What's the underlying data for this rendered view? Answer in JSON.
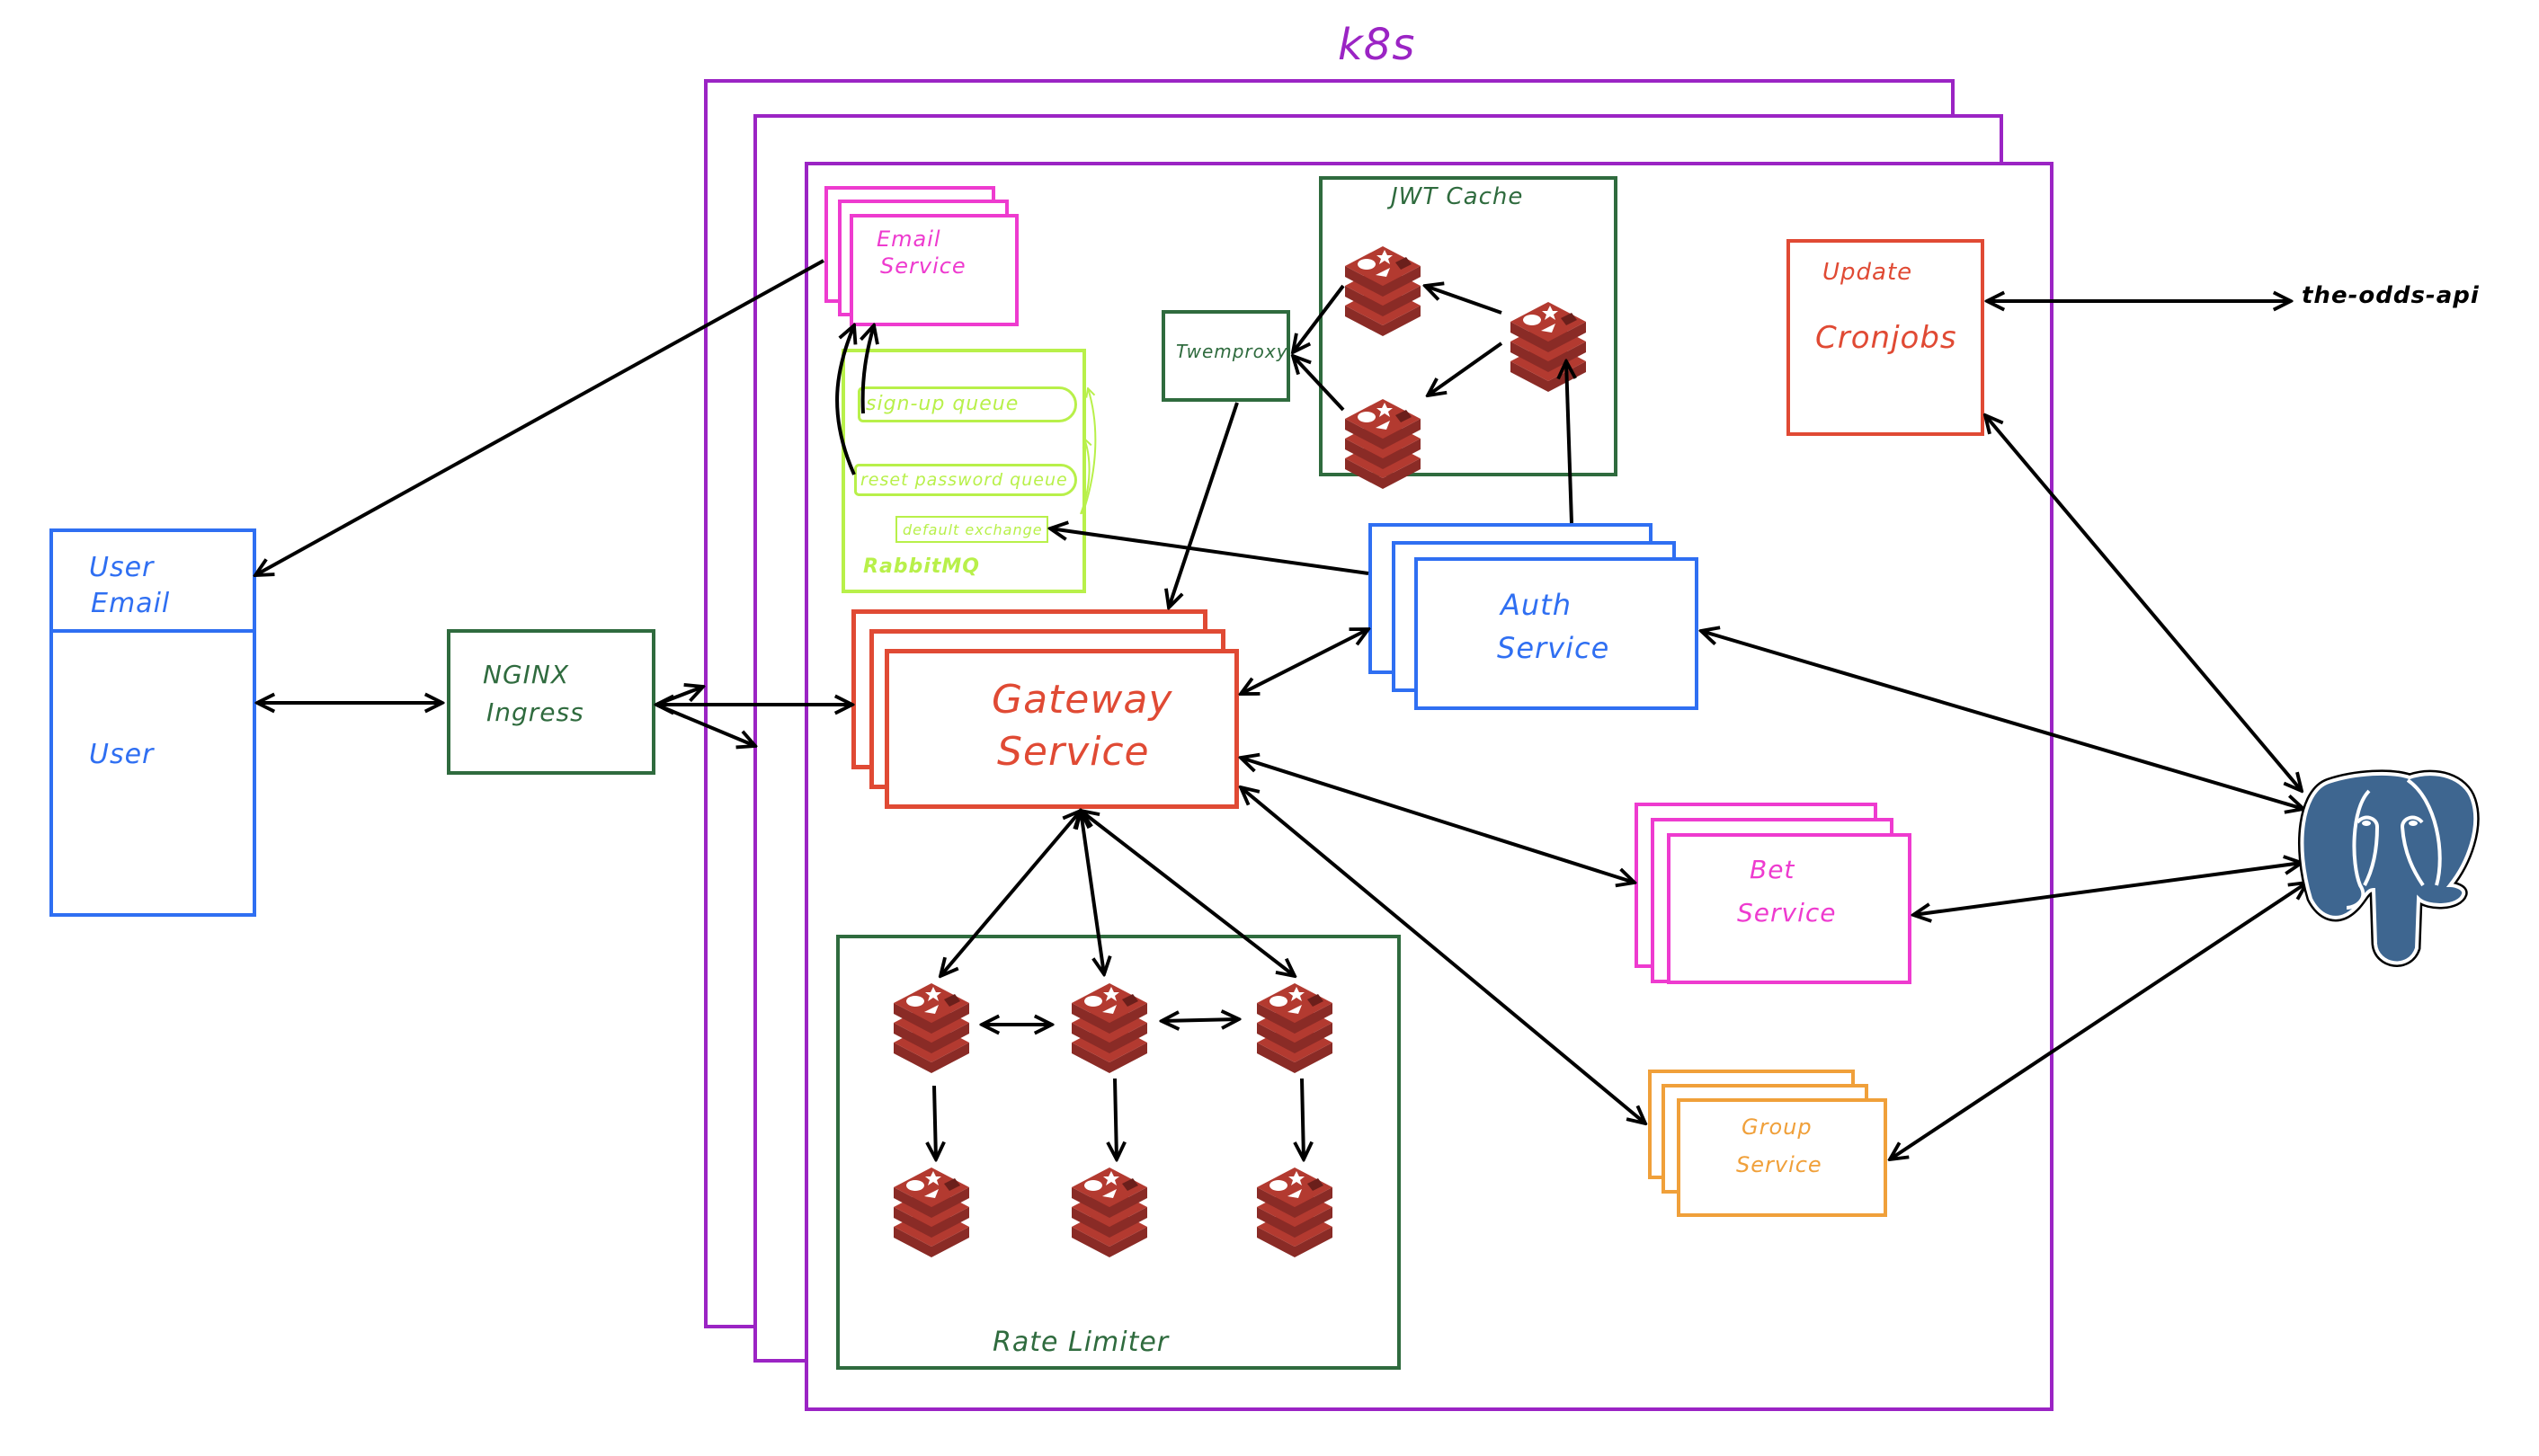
{
  "diagram": {
    "cluster_label": "k8s",
    "colors": {
      "k8s": "#9b24c4",
      "user": "#2f6ff2",
      "nginx": "#2f6b3e",
      "email": "#ee3bcf",
      "rabbit": "#b8f04a",
      "gateway": "#e04a34",
      "auth": "#2f6ff2",
      "bet": "#ee3bcf",
      "group": "#f0a03a",
      "cron": "#e04a34",
      "redis": "#b33a30",
      "redis_dark": "#8a2b26",
      "postgres": "#3e6690",
      "arrow": "#000000"
    },
    "user": {
      "top_label_line1": "User",
      "top_label_line2": "Email",
      "bottom_label": "User"
    },
    "nginx": {
      "line1": "NGINX",
      "line2": "Ingress"
    },
    "email_service": {
      "line1": "Email",
      "line2": "Service"
    },
    "rabbitmq": {
      "label": "RabbitMQ",
      "queues": [
        "sign-up queue",
        "reset password queue"
      ],
      "exchange": "default exchange"
    },
    "twemproxy": {
      "label": "Twemproxy"
    },
    "jwt_cache": {
      "label": "JWT Cache",
      "nodes": 3
    },
    "cronjobs": {
      "line1": "Update",
      "line2": "Cronjobs"
    },
    "external_api": {
      "label": "the-odds-api"
    },
    "gateway": {
      "line1": "Gateway",
      "line2": "Service"
    },
    "auth": {
      "line1": "Auth",
      "line2": "Service"
    },
    "bet": {
      "line1": "Bet",
      "line2": "Service"
    },
    "group": {
      "line1": "Group",
      "line2": "Service"
    },
    "rate_limiter": {
      "label": "Rate Limiter",
      "nodes": 6
    },
    "database": {
      "name": "postgres-icon"
    }
  }
}
